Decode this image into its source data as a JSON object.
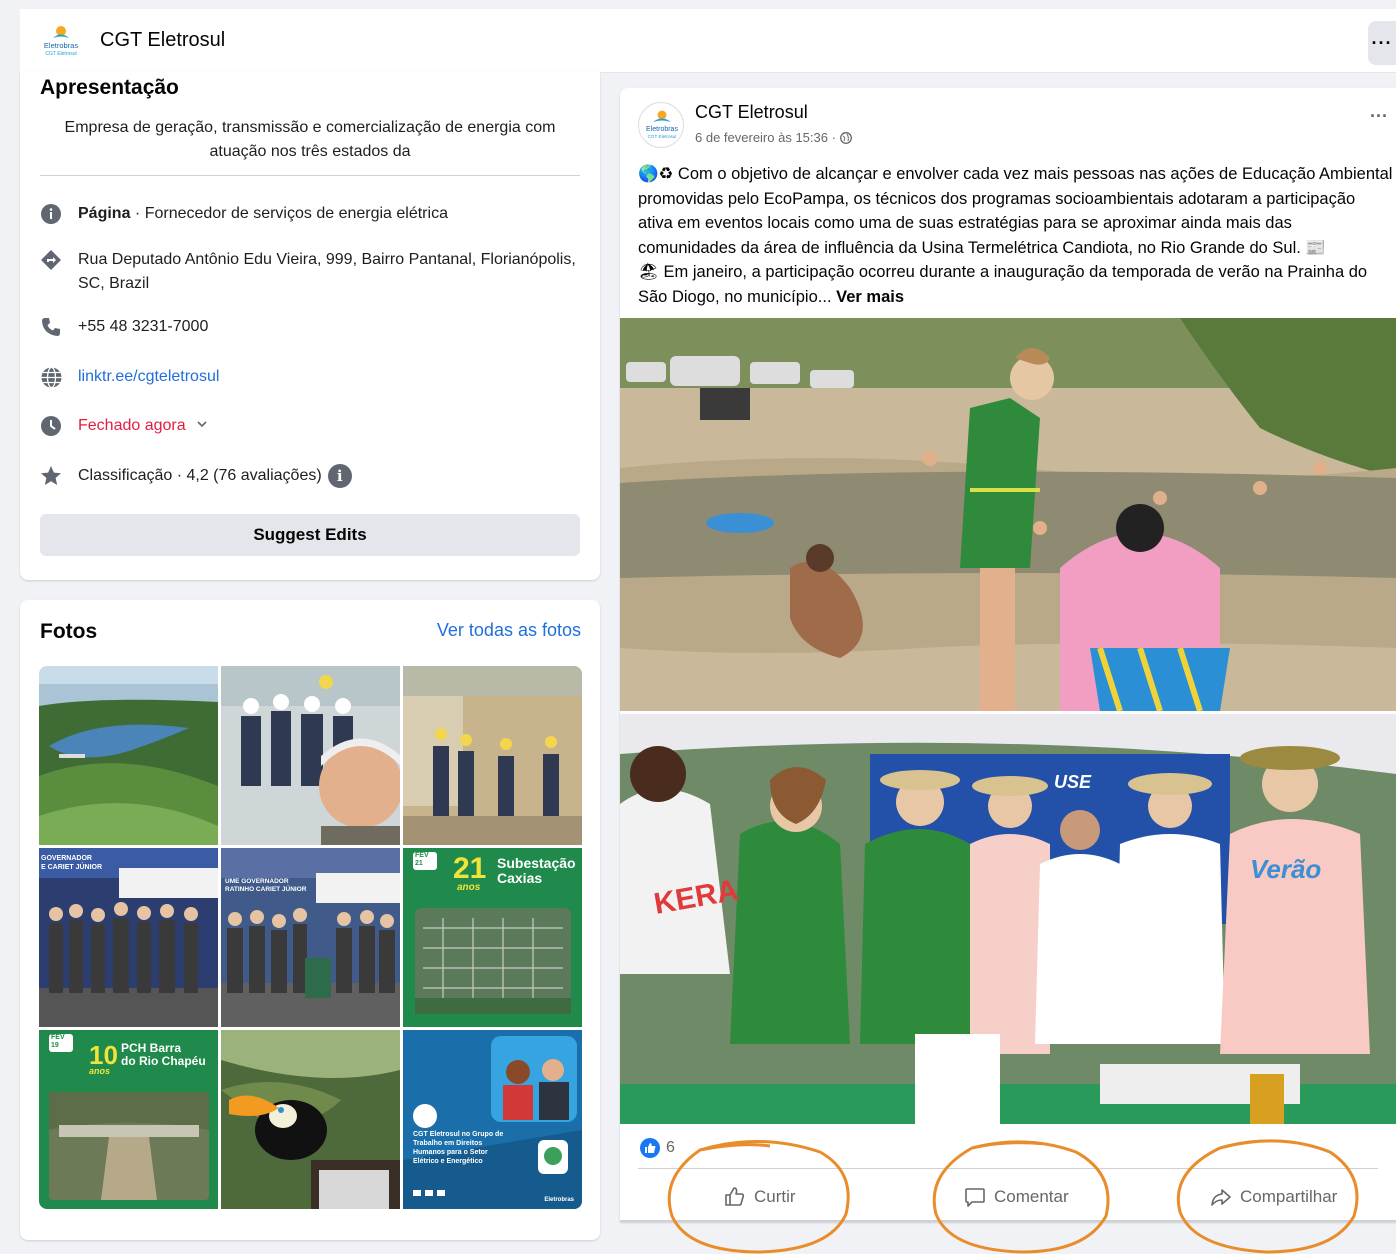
{
  "header": {
    "title": "CGT Eletrosul",
    "more": "···"
  },
  "intro": {
    "title": "Apresentação",
    "description": "Empresa de geração, transmissão e comercialização de energia com atuação nos três estados da",
    "category_prefix": "Página",
    "category": " · Fornecedor de serviços de energia elétrica",
    "address": "Rua Deputado Antônio Edu Vieira, 999, Bairro Pantanal, Florianópolis, SC, Brazil",
    "phone": "+55 48 3231-7000",
    "website": "linktr.ee/cgteletrosul",
    "hours": "Fechado agora",
    "rating": "Classificação · 4,2 (76 avaliações)",
    "suggest_edits": "Suggest Edits"
  },
  "photos": {
    "title": "Fotos",
    "see_all": "Ver todas as fotos",
    "tile_texts": {
      "governador": "GOVERNADOR\nE CARIET JÚNIOR",
      "governador2": "UME GOVERNADOR\nRATINHO CARIET JÚNIOR",
      "subestacao_num": "21",
      "subestacao_label": "Subestação\nCaxias",
      "subestacao_anos": "anos",
      "fev21": "FEV\n21",
      "fev19": "FEV\n19",
      "pch_num": "10",
      "pch_label": "PCH Barra\ndo Rio Chapéu",
      "pch_anos": "anos",
      "dh_text": "CGT Eletrosul no Grupo de Trabalho em Direitos Humanos para o Setor Elétrico e Energético",
      "dh_brand": "Eletrobras"
    }
  },
  "post": {
    "author": "CGT Eletrosul",
    "date": "6 de fevereiro às 15:36 · ",
    "text": "🌎♻ Com o objetivo de alcançar e envolver cada vez mais pessoas nas ações de Educação Ambiental promovidas pelo EcoPampa, os técnicos dos programas socioambientais adotaram a participação ativa em eventos locais como uma de suas estratégias para se aproximar ainda mais das comunidades da área de influência da Usina Termelétrica Candiota, no Rio Grande do Sul. 📰\n🏖 Em janeiro, a participação ocorreu durante a inauguração da temporada de verão na Prainha do São Diogo, no município... ",
    "see_more": "Ver mais",
    "likes": "6",
    "like_label": "Curtir",
    "comment_label": "Comentar",
    "share_label": "Compartilhar",
    "photo2_banner": "USE",
    "photo2_shirt": "Verão"
  },
  "colors": {
    "link": "#216fdb",
    "closed": "#e41e3f",
    "annotation": "#e98d2c",
    "like": "#1877f2"
  }
}
